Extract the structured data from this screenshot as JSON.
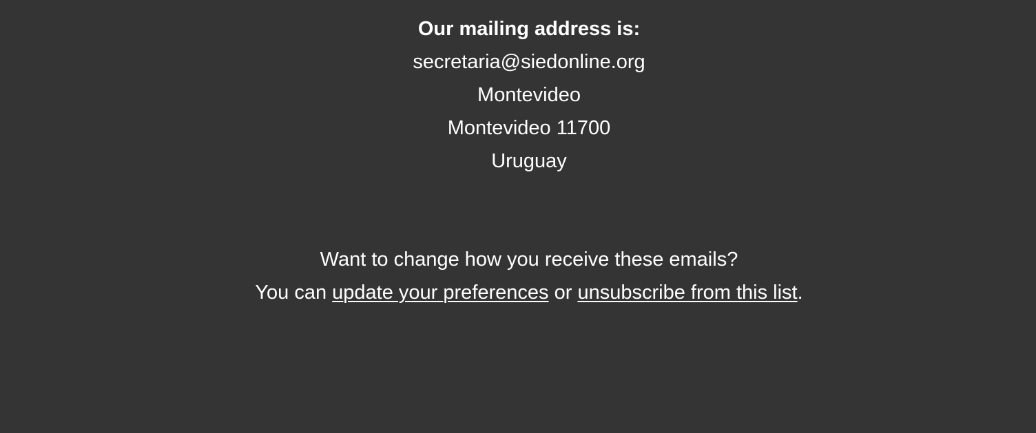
{
  "address": {
    "heading": "Our mailing address is:",
    "email": "secretaria@siedonline.org",
    "city": "Montevideo",
    "city_postal": "Montevideo 11700",
    "country": "Uruguay"
  },
  "preferences": {
    "question": "Want to change how you receive these emails?",
    "prefix": "You can ",
    "update_link": "update your preferences",
    "middle": " or ",
    "unsubscribe_link": "unsubscribe from this list",
    "suffix": "."
  },
  "colors": {
    "background": "#343434",
    "text": "#ffffff"
  }
}
